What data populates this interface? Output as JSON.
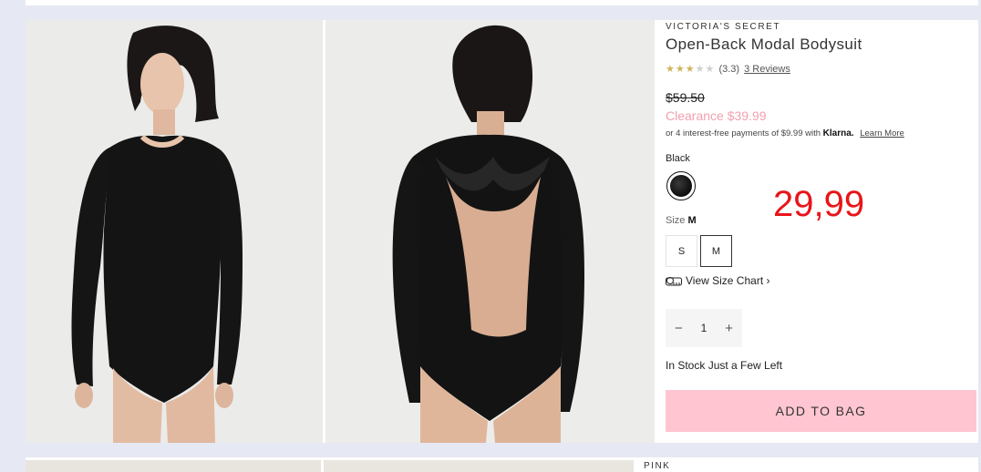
{
  "product": {
    "brand": "VICTORIA'S SECRET",
    "title": "Open-Back Modal Bodysuit",
    "rating": {
      "stars": 3.3,
      "star_glyphs": [
        "★",
        "★",
        "★",
        "★",
        "★"
      ],
      "score_text": "(3.3)",
      "reviews_link": "3 Reviews"
    },
    "original_price": "$59.50",
    "sale_price": "Clearance $39.99",
    "klarna": {
      "text": "or 4 interest-free payments of $9.99 with",
      "brand": "Klarna.",
      "link": "Learn More"
    },
    "color": {
      "label": "Black",
      "swatch_color": "#111111"
    },
    "size": {
      "label": "Size",
      "selected": "M",
      "options": [
        "S",
        "M"
      ]
    },
    "size_chart_link": "View Size Chart ›",
    "quantity": {
      "minus": "−",
      "value": "1",
      "plus": "+"
    },
    "stock_status": "In Stock Just a Few Left",
    "add_to_bag": "ADD TO BAG",
    "accent_color": "#ffc6d1"
  },
  "annotation": {
    "text": "29,99",
    "color": "#e8151a"
  },
  "next_product": {
    "brand": "PINK"
  }
}
